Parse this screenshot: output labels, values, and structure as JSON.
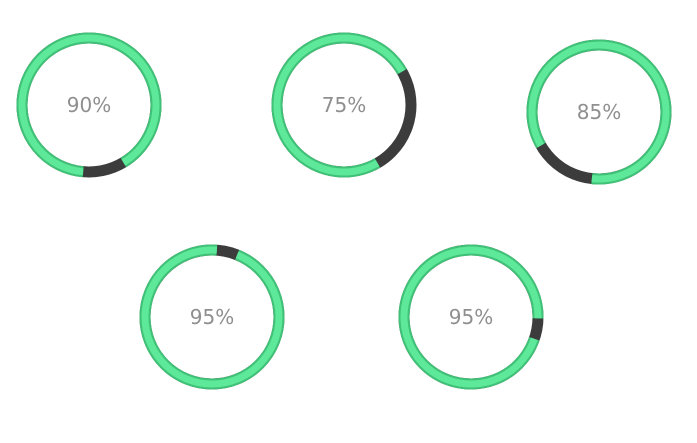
{
  "colors": {
    "progress": "#5ee89a",
    "progress_edge": "#3fc277",
    "remainder": "#3c3c3c",
    "label": "#8f8f8f"
  },
  "dials": [
    {
      "label": "90%",
      "value": 90,
      "start_deg": 95
    },
    {
      "label": "75%",
      "value": 75,
      "start_deg": 60
    },
    {
      "label": "85%",
      "value": 85,
      "start_deg": 150
    },
    {
      "label": "95%",
      "value": 95,
      "start_deg": 292
    },
    {
      "label": "95%",
      "value": 95,
      "start_deg": 19
    }
  ]
}
